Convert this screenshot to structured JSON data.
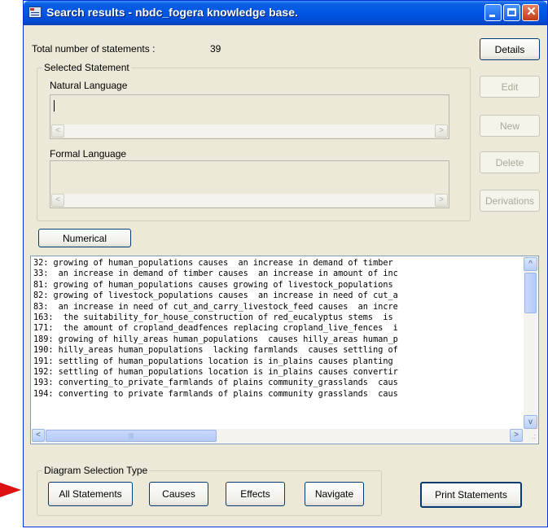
{
  "window": {
    "title": "Search results  - nbdc_fogera knowledge base."
  },
  "summary": {
    "total_label": "Total number of statements :",
    "total_value": "39"
  },
  "selected_statement": {
    "group_title": "Selected Statement",
    "natural_language_label": "Natural Language",
    "natural_language_value": "",
    "formal_language_label": "Formal Language",
    "formal_language_value": ""
  },
  "side_buttons": {
    "details": "Details",
    "edit": "Edit",
    "new": "New",
    "delete": "Delete",
    "derivations": "Derivations"
  },
  "numerical_button": "Numerical",
  "statements": [
    "32: growing of human_populations causes  an increase in demand of timber",
    "33:  an increase in demand of timber causes  an increase in amount of inc",
    "81: growing of human_populations causes growing of livestock_populations",
    "82: growing of livestock_populations causes  an increase in need of cut_a",
    "83:  an increase in need of cut_and_carry_livestock_feed causes  an incre",
    "163:  the suitability_for_house_construction of red_eucalyptus stems  is",
    "171:  the amount of cropland_deadfences replacing cropland_live_fences  i",
    "189: growing of hilly_areas human_populations  causes hilly_areas human_p",
    "190: hilly_areas human_populations  lacking farmlands  causes settling of",
    "191: settling of human_populations location is in_plains causes planting",
    "192: settling of human_populations location is in_plains causes convertir",
    "193: converting_to_private_farmlands of plains community_grasslands  caus",
    "194: converting to private farmlands of plains community grasslands  caus"
  ],
  "diagram_selection": {
    "group_title": "Diagram Selection Type",
    "all_statements": "All Statements",
    "causes": "Causes",
    "effects": "Effects",
    "navigate": "Navigate"
  },
  "print_button": "Print Statements",
  "colors": {
    "titlebar": "#0055e5",
    "window_bg": "#ece9d8",
    "annotation_arrow": "#dd1111"
  }
}
